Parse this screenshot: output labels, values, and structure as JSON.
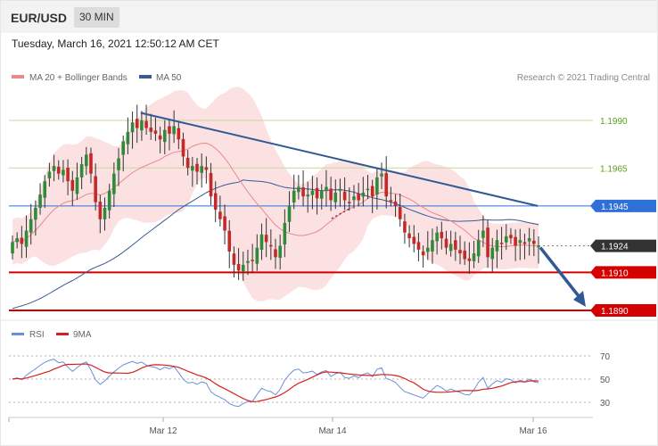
{
  "header": {
    "symbol": "EUR/USD",
    "timeframe": "30 MIN"
  },
  "timestamp": "Tuesday, March 16, 2021 12:50:12 AM CET",
  "legend": {
    "ma20": "MA 20 + Bollinger Bands",
    "ma50": "MA 50",
    "credit": "Research © 2021 Trading Central"
  },
  "colors": {
    "ma20": "#e88a8a",
    "ma50": "#3a5a92",
    "band": "#fadcdc",
    "bull": "#2e8b3a",
    "bear": "#c62828",
    "wick": "#333333",
    "fib": "#c9d89a",
    "fibText": "#5a9e1c",
    "blue": "#2f6fd8",
    "red": "#d40000",
    "dark": "#333333",
    "trend": "#2f5a94",
    "rsi": "#6b8fd6",
    "rsi9": "#d62020"
  },
  "chart_data": [
    {
      "type": "line",
      "panel": "price",
      "title": "EUR/USD",
      "x_ticks": [
        "Mar 12",
        "Mar 14",
        "Mar 16"
      ],
      "y_range": [
        1.1883,
        1.2002
      ],
      "levels": [
        {
          "value": 1.199,
          "label": "1.1990",
          "style": "resistance-line"
        },
        {
          "value": 1.1965,
          "label": "1.1965",
          "style": "resistance-line"
        },
        {
          "value": 1.1945,
          "label": "1.1945",
          "style": "blue-box"
        },
        {
          "value": 1.1924,
          "label": "1.1924",
          "style": "current-price"
        },
        {
          "value": 1.191,
          "label": "1.1910",
          "style": "support-red"
        },
        {
          "value": 1.189,
          "label": "1.1890",
          "style": "support-red"
        }
      ],
      "series": [
        {
          "name": "MA 20 + Bollinger Bands",
          "kind": "ma20"
        },
        {
          "name": "MA 50",
          "kind": "ma50"
        }
      ],
      "candles_close": [
        1.1926,
        1.1928,
        1.1925,
        1.1932,
        1.1938,
        1.1944,
        1.1951,
        1.1958,
        1.1963,
        1.1966,
        1.1962,
        1.1964,
        1.1958,
        1.1953,
        1.196,
        1.1967,
        1.1972,
        1.1962,
        1.1947,
        1.1938,
        1.1944,
        1.1953,
        1.1962,
        1.197,
        1.1979,
        1.1984,
        1.1989,
        1.1986,
        1.199,
        1.1986,
        1.1984,
        1.1983,
        1.198,
        1.1985,
        1.1983,
        1.1987,
        1.198,
        1.1971,
        1.1965,
        1.1966,
        1.1963,
        1.1966,
        1.1964,
        1.195,
        1.1943,
        1.1938,
        1.1932,
        1.1921,
        1.1914,
        1.1911,
        1.1914,
        1.1916,
        1.1916,
        1.1923,
        1.193,
        1.1926,
        1.1924,
        1.1918,
        1.1924,
        1.1936,
        1.1945,
        1.1953,
        1.1955,
        1.195,
        1.1951,
        1.1953,
        1.1949,
        1.1953,
        1.1955,
        1.1948,
        1.1952,
        1.1954,
        1.1948,
        1.1947,
        1.195,
        1.1948,
        1.1952,
        1.1954,
        1.195,
        1.196,
        1.1962,
        1.195,
        1.1948,
        1.1945,
        1.1938,
        1.1931,
        1.1928,
        1.1925,
        1.1922,
        1.1919,
        1.1923,
        1.1927,
        1.1931,
        1.1928,
        1.1923,
        1.1925,
        1.1922,
        1.192,
        1.1917,
        1.1916,
        1.192,
        1.1927,
        1.1932,
        1.1918,
        1.1923,
        1.1927,
        1.1925,
        1.1929,
        1.1928,
        1.1924,
        1.1927,
        1.1925,
        1.1928,
        1.1925,
        1.1924
      ],
      "trendline": {
        "from": {
          "index": 27,
          "value": 1.1994
        },
        "to": {
          "index": 115,
          "value": 1.1945
        }
      },
      "projection": {
        "from": 1.1924,
        "to": 1.189
      }
    },
    {
      "type": "line",
      "panel": "rsi",
      "series": [
        {
          "name": "RSI"
        },
        {
          "name": "9MA"
        }
      ],
      "y_ticks": [
        70,
        50,
        30
      ],
      "y_range": [
        18,
        82
      ]
    }
  ]
}
